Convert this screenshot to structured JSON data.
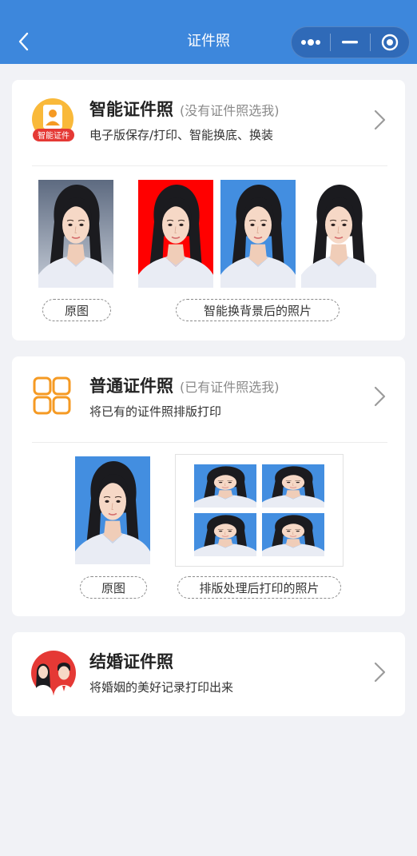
{
  "nav": {
    "title": "证件照"
  },
  "cards": [
    {
      "title": "智能证件照",
      "hint": "(没有证件照选我)",
      "subtitle": "电子版保存/打印、智能换底、换装",
      "badge": "智能证件",
      "original_label": "原图",
      "result_label": "智能换背景后的照片"
    },
    {
      "title": "普通证件照",
      "hint": "(已有证件照选我)",
      "subtitle": "将已有的证件照排版打印",
      "original_label": "原图",
      "result_label": "排版处理后打印的照片"
    },
    {
      "title": "结婚证件照",
      "subtitle": "将婚姻的美好记录打印出来"
    }
  ],
  "colors": {
    "nav_blue": "#3d87dc",
    "photo_red": "#ff0000",
    "photo_blue": "#438ee0",
    "icon_orange": "#f59a23",
    "chevron_gray": "#9b9b9b"
  }
}
